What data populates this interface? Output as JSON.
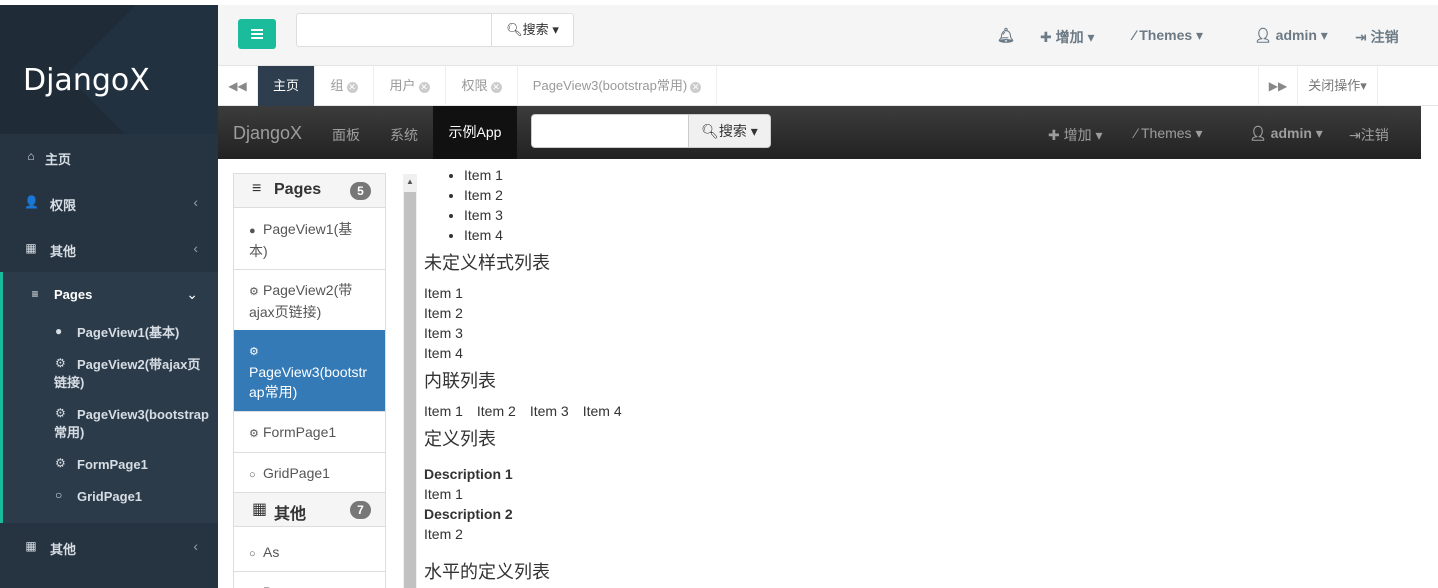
{
  "app": {
    "brand": "DjangoX"
  },
  "sidebar": {
    "items": [
      {
        "label": "主页",
        "icon": "home-icon"
      },
      {
        "label": "权限",
        "icon": "user-plus-icon"
      },
      {
        "label": "其他",
        "icon": "grid-icon"
      },
      {
        "label": "Pages",
        "icon": "list-icon"
      },
      {
        "label": "其他",
        "icon": "grid-icon"
      }
    ],
    "pages_sub": [
      {
        "label": "PageView1(基本)",
        "icon": "circle-icon"
      },
      {
        "label": "PageView2(带ajax页链接)",
        "icon": "gear-icon"
      },
      {
        "label": "PageView3(bootstrap常用)",
        "icon": "gear-icon"
      },
      {
        "label": "FormPage1",
        "icon": "gear-icon"
      },
      {
        "label": "GridPage1",
        "icon": "circle-outline-icon"
      }
    ]
  },
  "header": {
    "search_label": "搜索",
    "add_label": "增加",
    "themes_label": "Themes",
    "user_label": "admin",
    "logout_label": "注销"
  },
  "tabs": {
    "items": [
      {
        "label": "主页",
        "active": true
      },
      {
        "label": "组"
      },
      {
        "label": "用户"
      },
      {
        "label": "权限"
      },
      {
        "label": "PageView3(bootstrap常用)"
      }
    ],
    "close_ops_label": "关闭操作"
  },
  "innernav": {
    "brand": "DjangoX",
    "links": [
      "面板",
      "系统",
      "示例App"
    ],
    "search_label": "搜索",
    "add_label": "增加",
    "themes_label": "Themes",
    "user_label": "admin",
    "logout_label": "注销"
  },
  "list_panel": {
    "pages_header": "Pages",
    "pages_count": "5",
    "pages_items": [
      "PageView1(基本)",
      "PageView2(带ajax页链接)",
      "PageView3(bootstrap常用)",
      "FormPage1",
      "GridPage1"
    ],
    "other_header": "其他",
    "other_count": "7",
    "other_items": [
      "As",
      "B"
    ]
  },
  "content": {
    "list_items": [
      "Item 1",
      "Item 2",
      "Item 3",
      "Item 4"
    ],
    "unstyled_heading": "未定义样式列表",
    "unstyled_items": [
      "Item 1",
      "Item 2",
      "Item 3",
      "Item 4"
    ],
    "inline_heading": "内联列表",
    "inline_items": [
      "Item 1",
      "Item 2",
      "Item 3",
      "Item 4"
    ],
    "dl_heading": "定义列表",
    "dl": [
      {
        "term": "Description 1",
        "desc": "Item 1"
      },
      {
        "term": "Description 2",
        "desc": "Item 2"
      }
    ],
    "horizontal_dl_heading": "水平的定义列表"
  }
}
